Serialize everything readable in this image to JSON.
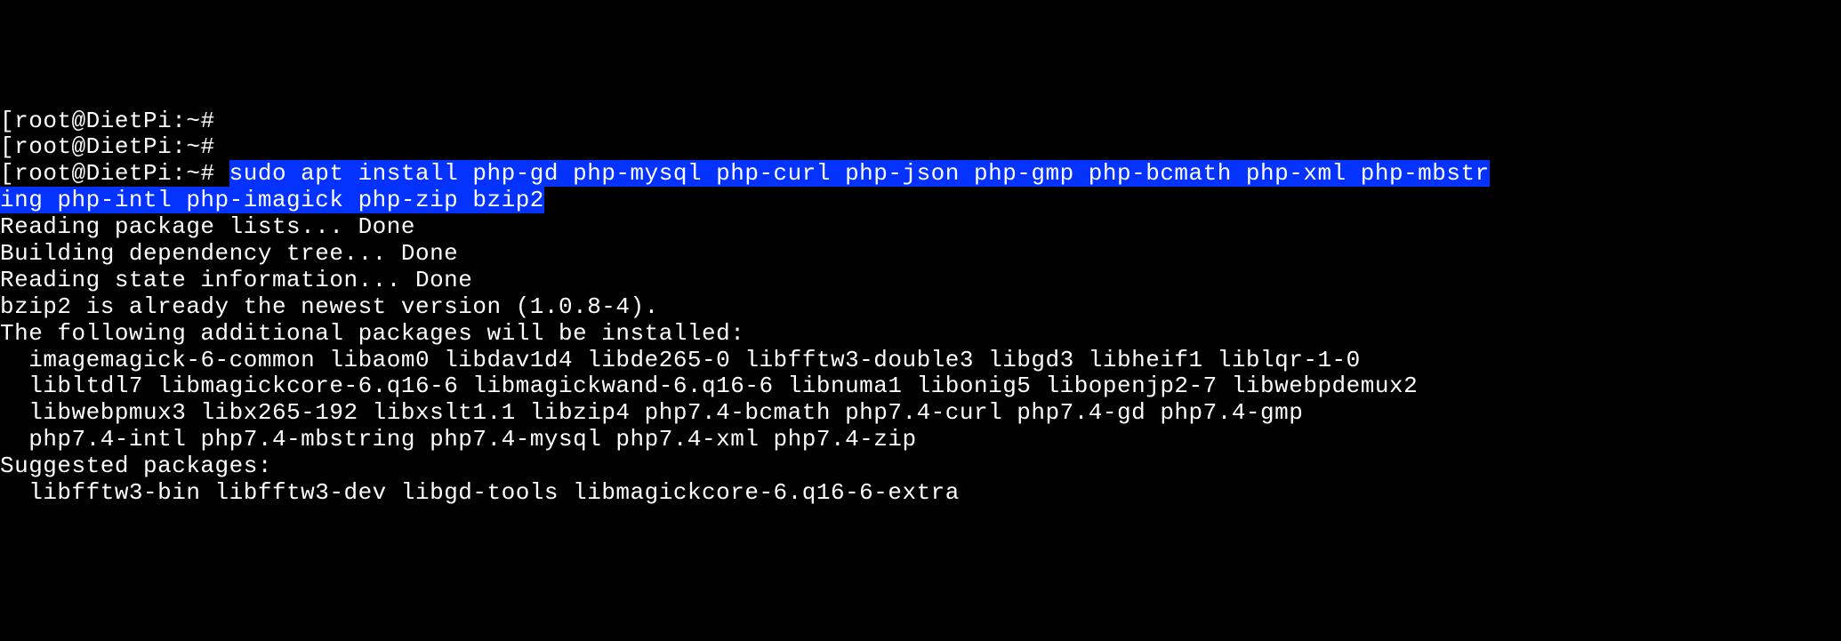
{
  "terminal": {
    "prompt_bracket_open": "[",
    "prompt_text": "root@DietPi:~#",
    "line1_command": "",
    "line2_command": "",
    "line3_command_part1": "sudo apt install php-gd php-mysql php-curl php-json php-gmp php-bcmath php-xml php-mbstr",
    "line3_command_part2": "ing php-intl php-imagick php-zip bzip2",
    "output": {
      "reading_lists": "Reading package lists... Done",
      "building_tree": "Building dependency tree... Done",
      "reading_state": "Reading state information... Done",
      "bzip2_newest": "bzip2 is already the newest version (1.0.8-4).",
      "additional_packages_header": "The following additional packages will be installed:",
      "additional_line1": "imagemagick-6-common libaom0 libdav1d4 libde265-0 libfftw3-double3 libgd3 libheif1 liblqr-1-0",
      "additional_line2": "libltdl7 libmagickcore-6.q16-6 libmagickwand-6.q16-6 libnuma1 libonig5 libopenjp2-7 libwebpdemux2",
      "additional_line3": "libwebpmux3 libx265-192 libxslt1.1 libzip4 php7.4-bcmath php7.4-curl php7.4-gd php7.4-gmp",
      "additional_line4": "php7.4-intl php7.4-mbstring php7.4-mysql php7.4-xml php7.4-zip",
      "suggested_header": "Suggested packages:",
      "suggested_line1": "libfftw3-bin libfftw3-dev libgd-tools libmagickcore-6.q16-6-extra"
    }
  }
}
